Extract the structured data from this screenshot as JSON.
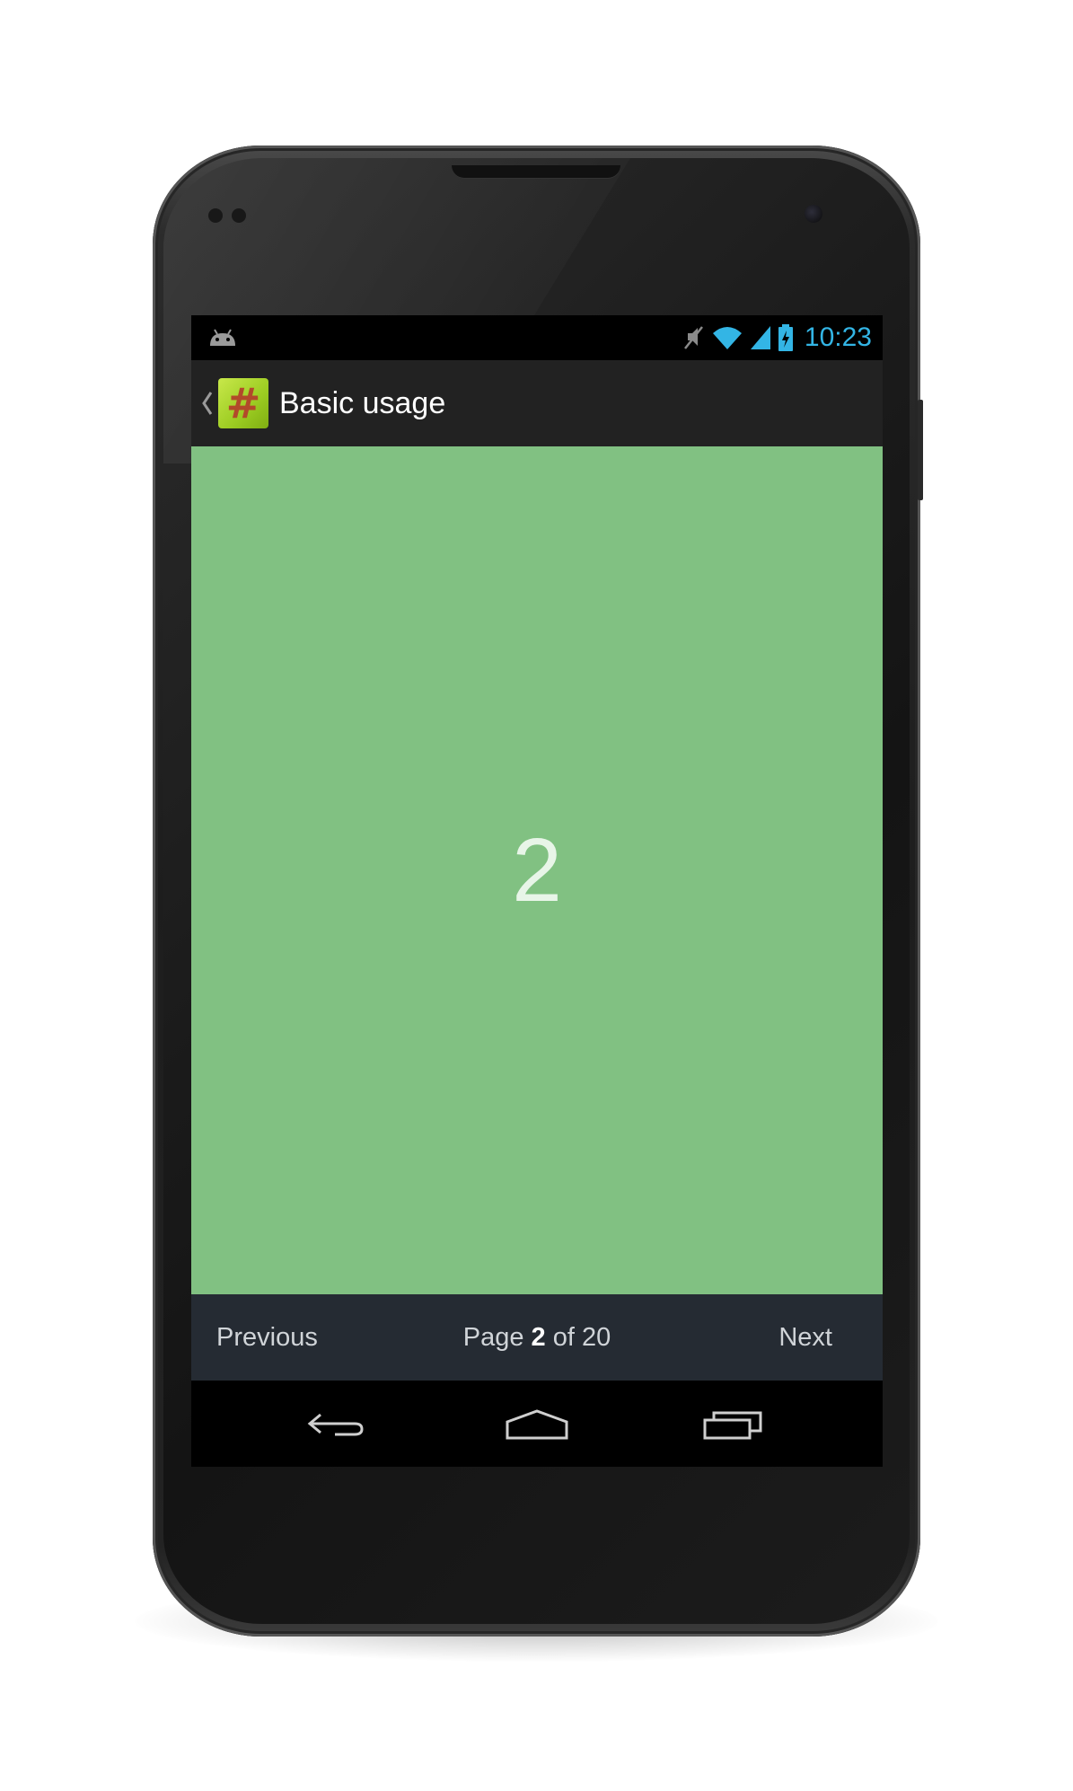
{
  "status_bar": {
    "time": "10:23",
    "accent_color": "#33b5e5",
    "icons": [
      "android-notification-icon",
      "mute-icon",
      "wifi-icon",
      "signal-icon",
      "battery-charging-icon"
    ]
  },
  "action_bar": {
    "title": "Basic usage",
    "app_icon_glyph": "#",
    "background": "#222222"
  },
  "pager": {
    "current_page_label": "2",
    "background": "#81c182"
  },
  "footer": {
    "previous_label": "Previous",
    "next_label": "Next",
    "page_prefix": "Page",
    "current_page": "2",
    "page_of": "of 20"
  },
  "nav_bar": {
    "buttons": [
      "back-icon",
      "home-icon",
      "recent-apps-icon"
    ]
  }
}
